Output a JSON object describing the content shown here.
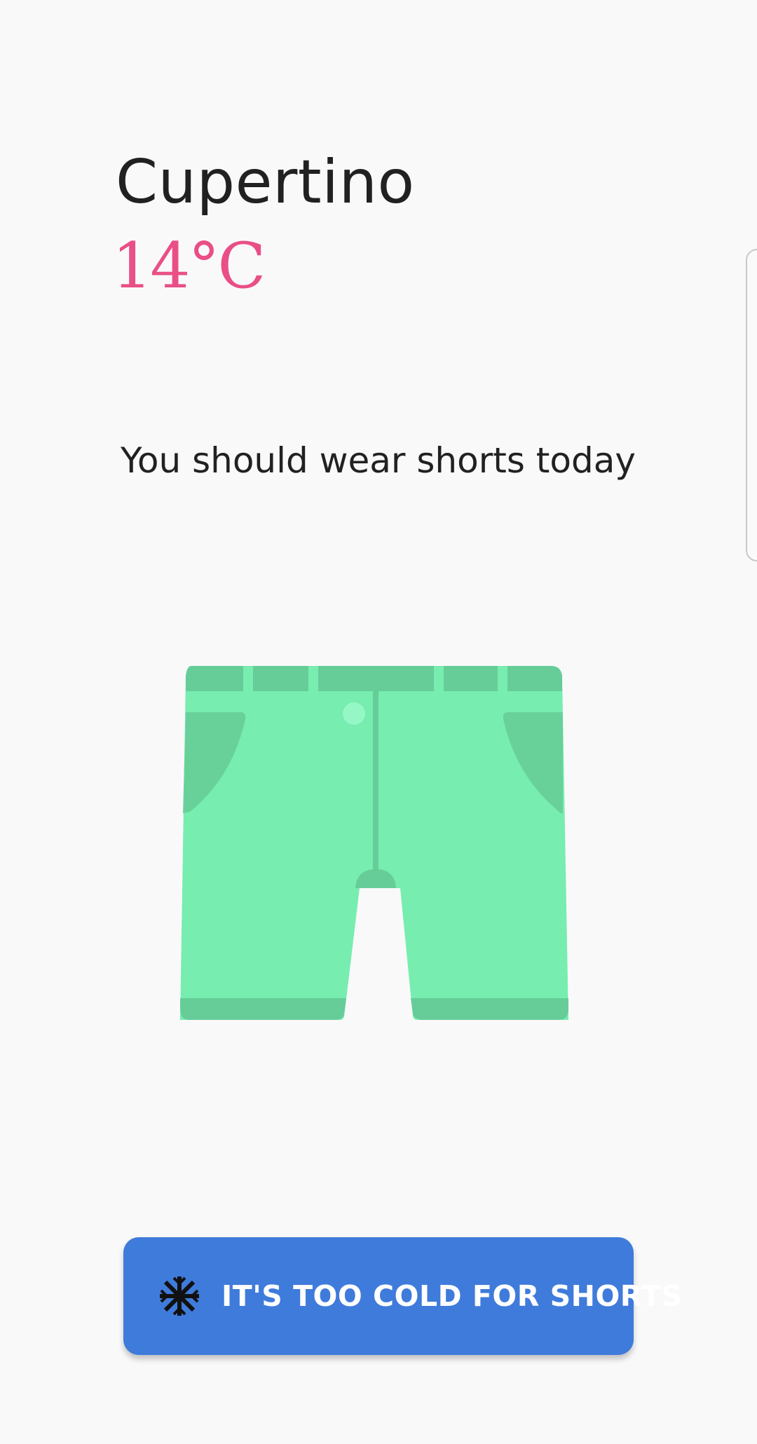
{
  "location": {
    "city": "Cupertino",
    "temperature": "14°C"
  },
  "recommendation": {
    "text": "You should wear shorts today"
  },
  "illustration": {
    "icon": "shorts-icon"
  },
  "action": {
    "label": "IT'S TOO COLD FOR SHORTS",
    "icon": "snowflake-icon"
  },
  "colors": {
    "background": "#f9f9fa",
    "temperature": "#e94f86",
    "button": "#3f7bdb",
    "shorts": "#77edb0",
    "shorts_shade": "#66cd98"
  }
}
